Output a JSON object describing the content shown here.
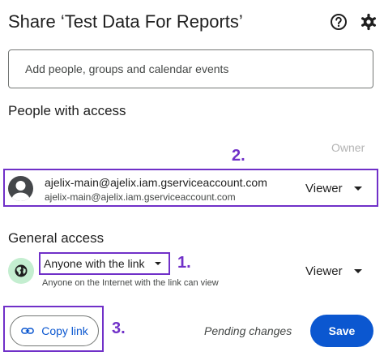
{
  "header": {
    "title": "Share ‘Test Data For Reports’",
    "help_icon": "help-circle-icon",
    "settings_icon": "gear-icon"
  },
  "add_people": {
    "placeholder": "Add people, groups and calendar events",
    "value": ""
  },
  "people_section": {
    "title": "People with access",
    "owner_label": "Owner",
    "users": [
      {
        "email": "ajelix-main@ajelix.iam.gserviceaccount.com",
        "subtitle": "ajelix-main@ajelix.iam.gserviceaccount.com",
        "role": "Viewer",
        "avatar_icon": "person-icon"
      }
    ]
  },
  "general_access": {
    "title": "General access",
    "link_setting": "Anyone with the link",
    "description": "Anyone on the Internet with the link can view",
    "role": "Viewer",
    "icon": "globe-icon"
  },
  "footer": {
    "copy_link_label": "Copy link",
    "pending_text": "Pending changes",
    "save_label": "Save"
  },
  "annotations": {
    "one": "1.",
    "two": "2.",
    "three": "3.",
    "color": "#7030c8"
  },
  "colors": {
    "accent": "#0b57d0",
    "globe_bg": "#c4eed0"
  }
}
